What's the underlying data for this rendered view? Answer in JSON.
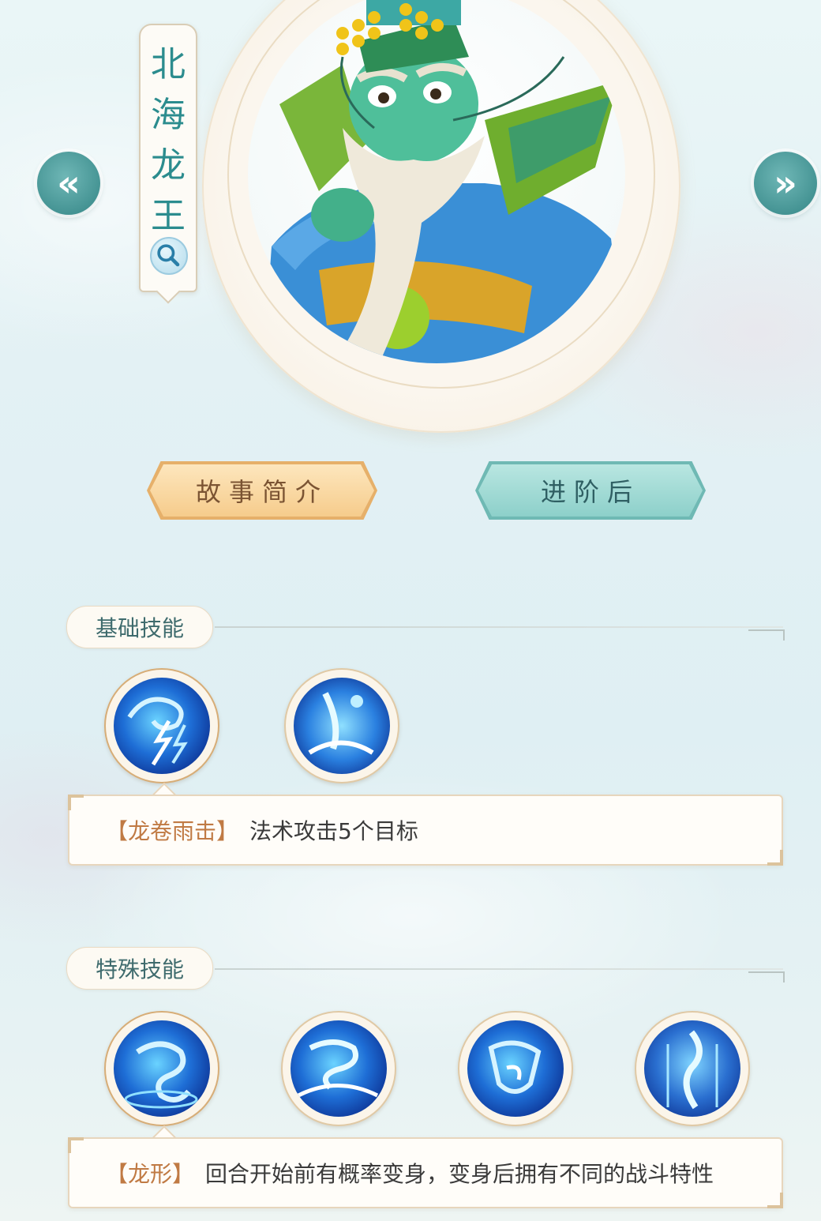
{
  "hero": {
    "name": "北海龙王",
    "portrait_icon": "dragon-king-portrait"
  },
  "nav": {
    "prev_icon": "double-chevron-left-icon",
    "next_icon": "double-chevron-right-icon",
    "prev_glyph": "«",
    "next_glyph": "»"
  },
  "tabs": {
    "story": "故事简介",
    "advanced": "进阶后"
  },
  "basic_skills": {
    "title": "基础技能",
    "items": [
      {
        "icon": "lightning-storm-skill-icon"
      },
      {
        "icon": "water-splash-skill-icon"
      }
    ],
    "selected": {
      "name": "【龙卷雨击】",
      "description": "法术攻击5个目标"
    }
  },
  "special_skills": {
    "title": "特殊技能",
    "items": [
      {
        "icon": "dragon-form-skill-icon"
      },
      {
        "icon": "dragon-wave-skill-icon"
      },
      {
        "icon": "dragon-shield-skill-icon"
      },
      {
        "icon": "dragon-pillar-skill-icon"
      }
    ],
    "selected": {
      "name": "【龙形】",
      "description": "回合开始前有概率变身，变身后拥有不同的战斗特性"
    }
  },
  "colors": {
    "accent_teal": "#3f8f8f",
    "name_color": "#2b8c8e",
    "skill_name_color": "#c07a44",
    "tab_story_bg": "#f6cc8c",
    "tab_advanced_bg": "#8dd0ca"
  }
}
